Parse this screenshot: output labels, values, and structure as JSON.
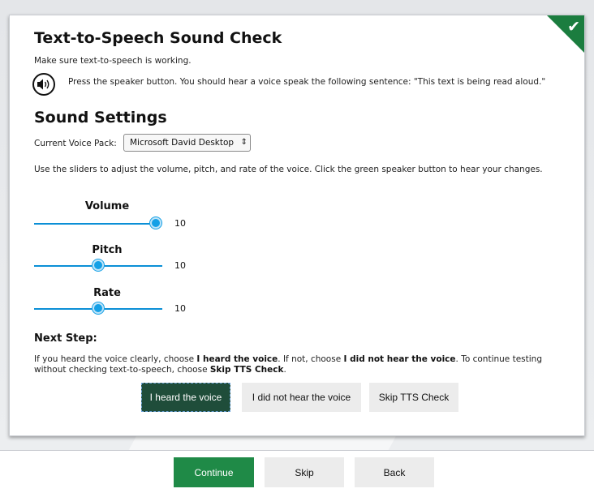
{
  "header": {
    "title": "Text-to-Speech Sound Check",
    "subtitle": "Make sure text-to-speech is working.",
    "instruction": "Press the speaker button. You should hear a voice speak the following sentence: \"This text is being read aloud.\""
  },
  "icons": {
    "speaker": "speaker-icon",
    "complete": "checkmark-icon"
  },
  "colors": {
    "accent_green": "#1f8a47",
    "selected_button": "#1f4d3a",
    "slider_blue": "#14a0e6"
  },
  "sound_settings": {
    "title": "Sound Settings",
    "voice_pack_label": "Current Voice Pack:",
    "voice_pack_value": "Microsoft David Desktop",
    "description": "Use the sliders to adjust the volume, pitch, and rate of the voice. Click the green speaker button to hear your changes.",
    "sliders": [
      {
        "label": "Volume",
        "value": "10",
        "level": 1.0
      },
      {
        "label": "Pitch",
        "value": "10",
        "level": 0.5
      },
      {
        "label": "Rate",
        "value": "10",
        "level": 0.5
      }
    ]
  },
  "next_step": {
    "title": "Next Step:",
    "text_1": "If you heard the voice clearly, choose ",
    "bold_1": "I heard the voice",
    "text_2": ". If not, choose ",
    "bold_2": "I did not hear the voice",
    "text_3": ". To continue testing without checking text-to-speech, choose ",
    "bold_3": "Skip TTS Check",
    "text_4": "."
  },
  "choices": {
    "heard": "I heard the voice",
    "not_heard": "I did not hear the voice",
    "skip_tts": "Skip TTS Check"
  },
  "footer": {
    "continue": "Continue",
    "skip": "Skip",
    "back": "Back"
  }
}
